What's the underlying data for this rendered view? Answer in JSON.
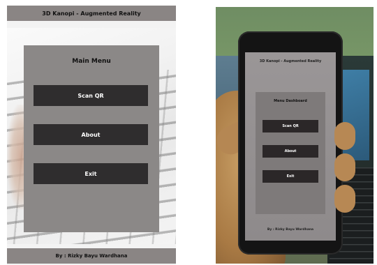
{
  "app": {
    "title": "3D Kanopi - Augmented Reality",
    "menu_title": "Main Menu",
    "buttons": {
      "scan_qr": "Scan QR",
      "about": "About",
      "exit": "Exit"
    },
    "footer": "By : Rizky Bayu Wardhana"
  },
  "phone_photo": {
    "title": "3D Kanopi - Augmented Reality",
    "menu_title": "Menu Dashboard",
    "buttons": {
      "scan_qr": "Scan QR",
      "about": "About",
      "exit": "Exit"
    },
    "footer": "By : Rizky Bayu Wardhana"
  },
  "colors": {
    "bar": "#8a8584",
    "panel": "#8b8887",
    "button": "#2f2d2e",
    "button_text": "#ffffff"
  }
}
